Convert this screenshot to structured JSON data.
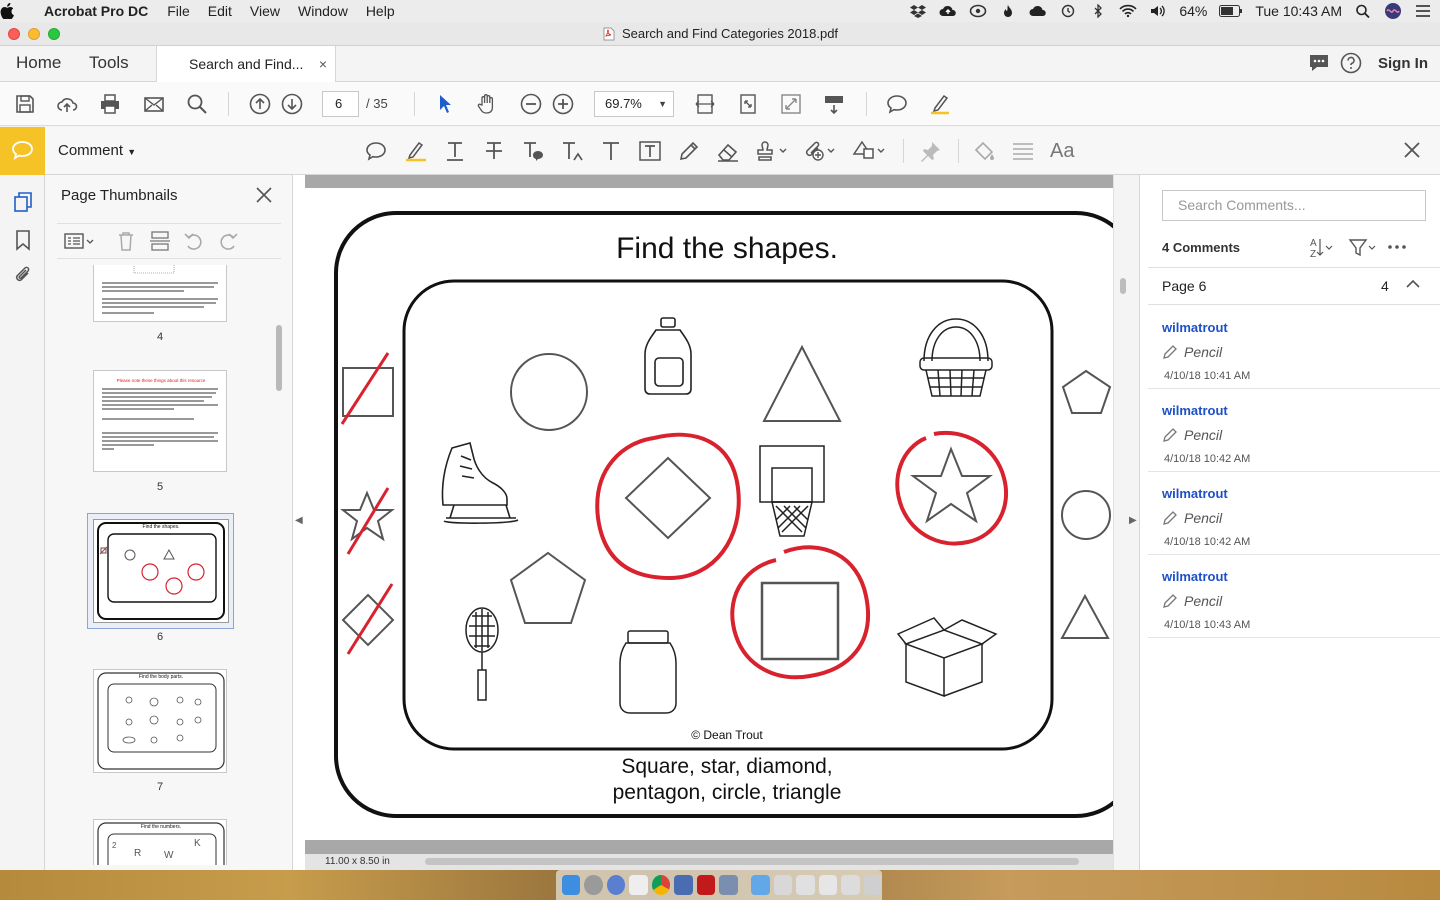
{
  "menubar": {
    "app_name": "Acrobat Pro DC",
    "menus": [
      "File",
      "Edit",
      "View",
      "Window",
      "Help"
    ],
    "battery": "64%",
    "clock": "Tue 10:43 AM"
  },
  "window": {
    "title": "Search and Find Categories 2018.pdf"
  },
  "tabs": {
    "home": "Home",
    "tools": "Tools",
    "doc_tab": "Search and Find...",
    "doc_tab_close": "×",
    "sign_in": "Sign In"
  },
  "toolbar": {
    "page_current": "6",
    "page_total": "/ 35",
    "zoom": "69.7%"
  },
  "comment_bar": {
    "label": "Comment",
    "font_tool": "Aa"
  },
  "thumbnails": {
    "title": "Page Thumbnails",
    "pages": [
      {
        "label": "4"
      },
      {
        "label": "5",
        "note_heading": "Please note these things about this resource"
      },
      {
        "label": "6",
        "title": "Find the shapes."
      },
      {
        "label": "7",
        "title": "Find the body parts."
      },
      {
        "label": "",
        "title": "Find the numbers."
      }
    ]
  },
  "document": {
    "page_title": "Find the shapes.",
    "copyright": "© Dean Trout",
    "answer_line1": "Square, star, diamond,",
    "answer_line2": "pentagon, circle, triangle",
    "page_size": "11.00 x 8.50 in"
  },
  "comments": {
    "search_placeholder": "Search Comments...",
    "count_label": "4 Comments",
    "page_label": "Page 6",
    "page_count": "4",
    "items": [
      {
        "author": "wilmatrout",
        "type": "Pencil",
        "date": "4/10/18  10:41 AM"
      },
      {
        "author": "wilmatrout",
        "type": "Pencil",
        "date": "4/10/18  10:42 AM"
      },
      {
        "author": "wilmatrout",
        "type": "Pencil",
        "date": "4/10/18  10:42 AM"
      },
      {
        "author": "wilmatrout",
        "type": "Pencil",
        "date": "4/10/18  10:43 AM"
      }
    ]
  },
  "colors": {
    "accent_yellow": "#f6c327",
    "author_blue": "#1c4fc8",
    "markup_red": "#d8232f"
  }
}
